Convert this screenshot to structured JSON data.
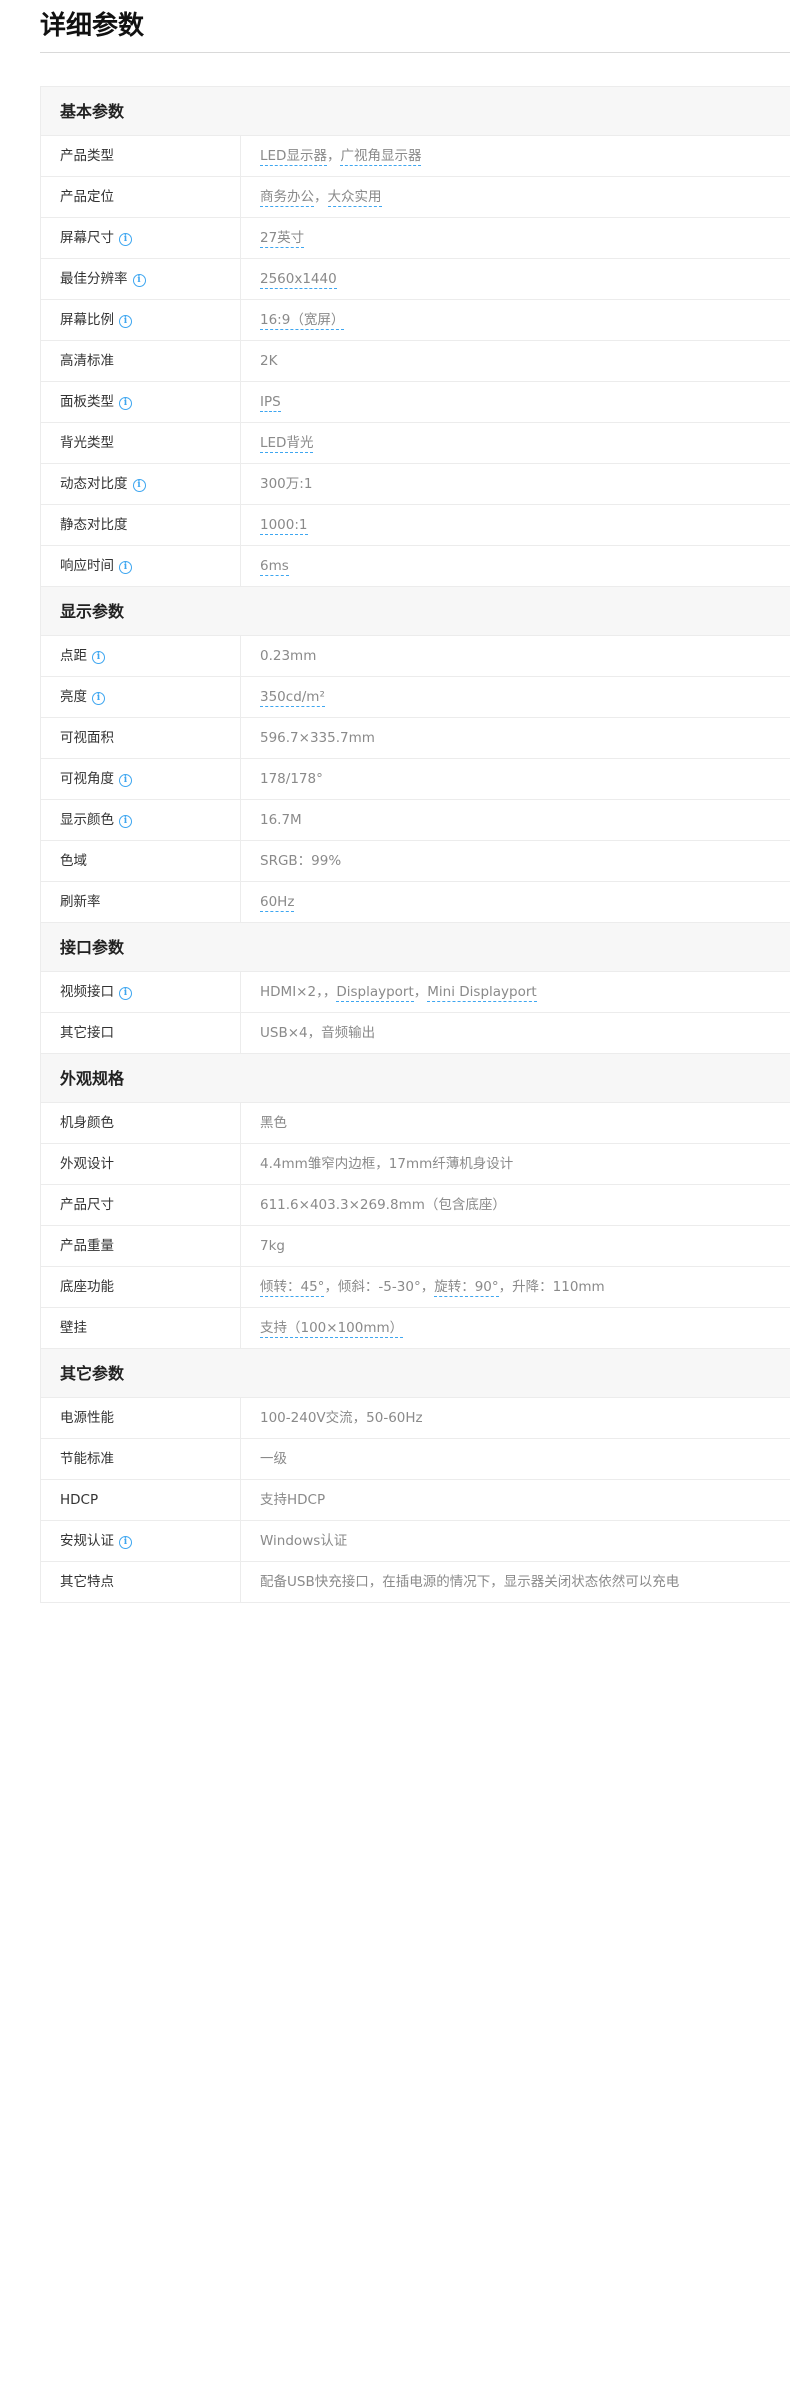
{
  "page": {
    "title": "详细参数"
  },
  "accent_color": "#3ea6f0",
  "sections": [
    {
      "title": "基本参数",
      "rows": [
        {
          "name": "产品类型",
          "info": false,
          "value": [
            {
              "text": "LED显示器",
              "link": true
            },
            {
              "text": "，",
              "link": false
            },
            {
              "text": "广视角显示器",
              "link": true
            }
          ]
        },
        {
          "name": "产品定位",
          "info": false,
          "value": [
            {
              "text": "商务办公",
              "link": true
            },
            {
              "text": "，",
              "link": false
            },
            {
              "text": "大众实用",
              "link": true
            }
          ]
        },
        {
          "name": "屏幕尺寸",
          "info": true,
          "value": [
            {
              "text": "27英寸",
              "link": true
            }
          ]
        },
        {
          "name": "最佳分辨率",
          "info": true,
          "value": [
            {
              "text": "2560x1440",
              "link": true
            }
          ]
        },
        {
          "name": "屏幕比例",
          "info": true,
          "value": [
            {
              "text": "16:9（宽屏）",
              "link": true
            }
          ]
        },
        {
          "name": "高清标准",
          "info": false,
          "value": [
            {
              "text": "2K",
              "link": false
            }
          ]
        },
        {
          "name": "面板类型",
          "info": true,
          "value": [
            {
              "text": "IPS",
              "link": true
            }
          ]
        },
        {
          "name": "背光类型",
          "info": false,
          "value": [
            {
              "text": "LED背光",
              "link": true
            }
          ]
        },
        {
          "name": "动态对比度",
          "info": true,
          "value": [
            {
              "text": "300万:1",
              "link": false
            }
          ]
        },
        {
          "name": "静态对比度",
          "info": false,
          "value": [
            {
              "text": "1000:1",
              "link": true
            }
          ]
        },
        {
          "name": "响应时间",
          "info": true,
          "value": [
            {
              "text": "6ms",
              "link": true
            }
          ]
        }
      ]
    },
    {
      "title": "显示参数",
      "rows": [
        {
          "name": "点距",
          "info": true,
          "value": [
            {
              "text": "0.23mm",
              "link": false
            }
          ]
        },
        {
          "name": "亮度",
          "info": true,
          "value": [
            {
              "text": "350cd/m²",
              "link": true
            }
          ]
        },
        {
          "name": "可视面积",
          "info": false,
          "value": [
            {
              "text": "596.7×335.7mm",
              "link": false
            }
          ]
        },
        {
          "name": "可视角度",
          "info": true,
          "value": [
            {
              "text": "178/178°",
              "link": false
            }
          ]
        },
        {
          "name": "显示颜色",
          "info": true,
          "value": [
            {
              "text": "16.7M",
              "link": false
            }
          ]
        },
        {
          "name": "色域",
          "info": false,
          "value": [
            {
              "text": "SRGB：99%",
              "link": false
            }
          ]
        },
        {
          "name": "刷新率",
          "info": false,
          "value": [
            {
              "text": "60Hz",
              "link": true
            }
          ]
        }
      ]
    },
    {
      "title": "接口参数",
      "rows": [
        {
          "name": "视频接口",
          "info": true,
          "value": [
            {
              "text": "HDMI×2，，",
              "link": false
            },
            {
              "text": "Displayport",
              "link": true
            },
            {
              "text": "，",
              "link": false
            },
            {
              "text": "Mini Displayport",
              "link": true
            }
          ]
        },
        {
          "name": "其它接口",
          "info": false,
          "value": [
            {
              "text": "USB×4，音频输出",
              "link": false
            }
          ]
        }
      ]
    },
    {
      "title": "外观规格",
      "rows": [
        {
          "name": "机身颜色",
          "info": false,
          "value": [
            {
              "text": "黑色",
              "link": false
            }
          ]
        },
        {
          "name": "外观设计",
          "info": false,
          "value": [
            {
              "text": "4.4mm雏窄内边框，17mm纤薄机身设计",
              "link": false
            }
          ]
        },
        {
          "name": "产品尺寸",
          "info": false,
          "value": [
            {
              "text": "611.6×403.3×269.8mm（包含底座）",
              "link": false
            }
          ]
        },
        {
          "name": "产品重量",
          "info": false,
          "value": [
            {
              "text": "7kg",
              "link": false
            }
          ]
        },
        {
          "name": "底座功能",
          "info": false,
          "value": [
            {
              "text": "倾转：45°",
              "link": true
            },
            {
              "text": "，倾斜：-5-30°，",
              "link": false
            },
            {
              "text": "旋转：90°",
              "link": true
            },
            {
              "text": "，升降：110mm",
              "link": false
            }
          ]
        },
        {
          "name": "壁挂",
          "info": false,
          "value": [
            {
              "text": "支持（100×100mm）",
              "link": true
            }
          ]
        }
      ]
    },
    {
      "title": "其它参数",
      "rows": [
        {
          "name": "电源性能",
          "info": false,
          "value": [
            {
              "text": "100-240V交流，50-60Hz",
              "link": false
            }
          ]
        },
        {
          "name": "节能标准",
          "info": false,
          "value": [
            {
              "text": "一级",
              "link": false
            }
          ]
        },
        {
          "name": "HDCP",
          "info": false,
          "value": [
            {
              "text": "支持HDCP",
              "link": false
            }
          ]
        },
        {
          "name": "安规认证",
          "info": true,
          "value": [
            {
              "text": "Windows认证",
              "link": false
            }
          ]
        },
        {
          "name": "其它特点",
          "info": false,
          "value": [
            {
              "text": "配备USB快充接口，在插电源的情况下，显示器关闭状态依然可以充电",
              "link": false
            }
          ]
        }
      ]
    }
  ]
}
